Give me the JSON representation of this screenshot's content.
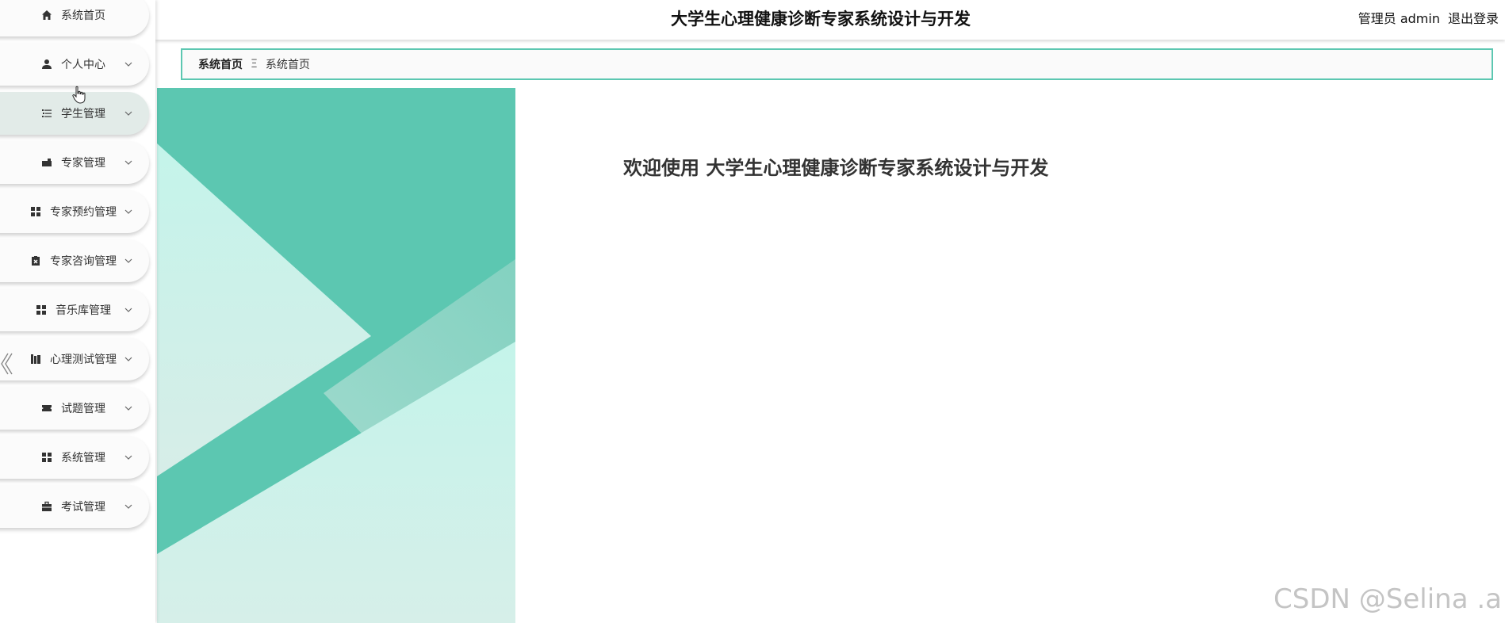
{
  "header": {
    "title": "大学生心理健康诊断专家系统设计与开发",
    "user": "管理员 admin",
    "logout": "退出登录"
  },
  "sidebar": {
    "items": [
      {
        "label": "系统首页",
        "icon": "home-icon"
      },
      {
        "label": "个人中心",
        "icon": "user-icon"
      },
      {
        "label": "学生管理",
        "icon": "list-icon"
      },
      {
        "label": "专家管理",
        "icon": "briefcase-icon"
      },
      {
        "label": "专家预约管理",
        "icon": "grid-icon"
      },
      {
        "label": "专家咨询管理",
        "icon": "clipboard-icon"
      },
      {
        "label": "音乐库管理",
        "icon": "grid-icon"
      },
      {
        "label": "心理测试管理",
        "icon": "books-icon"
      },
      {
        "label": "试题管理",
        "icon": "ticket-icon"
      },
      {
        "label": "系统管理",
        "icon": "grid-icon"
      },
      {
        "label": "考试管理",
        "icon": "toolbox-icon"
      }
    ]
  },
  "breadcrumb": {
    "first": "系统首页",
    "separator": "Ξ",
    "current": "系统首页"
  },
  "main": {
    "welcome": "欢迎使用 大学生心理健康诊断专家系统设计与开发"
  },
  "watermark": "CSDN @Selina .a",
  "colors": {
    "accent": "#5cc7b1",
    "hero_dark": "#5cc7b1",
    "hero_light": "#c4f4ea"
  }
}
